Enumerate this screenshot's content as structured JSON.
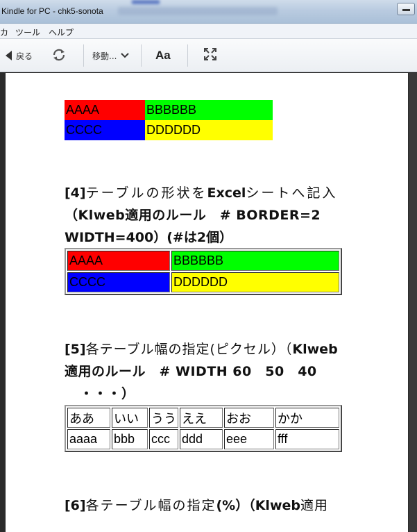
{
  "window": {
    "title": "Kindle for PC - chk5-sonota"
  },
  "menu": {
    "items": [
      "カ",
      "ツール",
      "ヘルプ"
    ]
  },
  "toolbar": {
    "back_label": "戻る",
    "goto_label": "移動...",
    "font_label": "Aa",
    "icons": {
      "back": "back-triangle-icon",
      "sync": "sync-icon",
      "goto": "chevron-down-icon",
      "fullscreen": "fullscreen-icon"
    }
  },
  "content": {
    "table1": {
      "rows": [
        [
          {
            "text": "AAAA",
            "color": "#ff0000"
          },
          {
            "text": "BBBBBB",
            "color": "#00ff00"
          }
        ],
        [
          {
            "text": "CCCC",
            "color": "#0000ff"
          },
          {
            "text": "DDDDDD",
            "color": "#ffff00"
          }
        ]
      ]
    },
    "section4": {
      "number": "[4]",
      "line1_text": "テーブルの形状を",
      "line1_bold": "Excel",
      "line1_tail": "シートへ記入",
      "line2": "（Klweb適用のルール　# BORDER=2",
      "line3": "WIDTH=400）(#は2個）",
      "table": {
        "rows": [
          [
            {
              "text": "AAAA",
              "color": "#ff0000"
            },
            {
              "text": "BBBBBB",
              "color": "#00ff00"
            }
          ],
          [
            {
              "text": "CCCC",
              "color": "#0000ff"
            },
            {
              "text": "DDDDDD",
              "color": "#ffff00"
            }
          ]
        ]
      }
    },
    "section5": {
      "number": "[5]",
      "line1_text": "各テーブル幅の指定",
      "line1_paren": "(ピクセル）（",
      "line1_bold": "Klweb",
      "line2": "適用のルール　# WIDTH 60　50　40",
      "line3": "・・・）",
      "table": {
        "header": [
          "ああ",
          "いい",
          "うう",
          "ええ",
          "おお",
          "かか"
        ],
        "row": [
          "aaaa",
          "bbb",
          "ccc",
          "ddd",
          "eee",
          "fff"
        ]
      }
    },
    "section6": {
      "number": "[6]",
      "line1_text": "各テーブル幅の指定",
      "line1_paren": "(%）（",
      "line1_bold": "Klweb",
      "line1_tail": "適用"
    }
  }
}
